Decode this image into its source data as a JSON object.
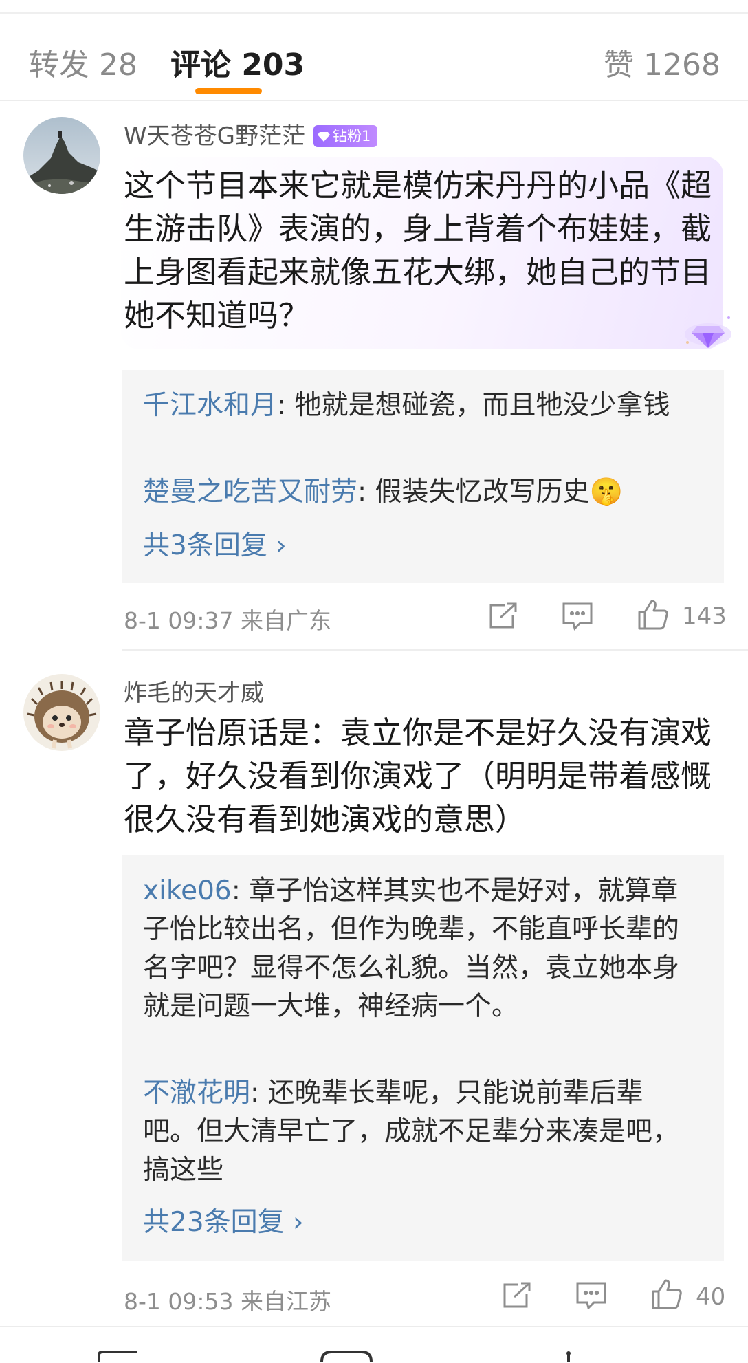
{
  "tabs": {
    "repost": "转发 28",
    "comments": "评论 203",
    "likes": "赞 1268"
  },
  "comments": [
    {
      "username": "W天苍苍G野茫茫",
      "badge": "钻粉1",
      "text": "这个节目本来它就是模仿宋丹丹的小品《超生游击队》表演的，身上背着个布娃娃，截上身图看起来就像五花大绑，她自己的节目她不知道吗？",
      "replies": [
        {
          "user": "千江水和月",
          "text": ": 牠就是想碰瓷，而且牠没少拿钱"
        },
        {
          "user": "楚曼之吃苦又耐劳",
          "text": ": 假装失忆改写历史🤫"
        }
      ],
      "more_replies": "共3条回复 ›",
      "time": "8-1 09:37",
      "location": "来自广东",
      "likes": "143"
    },
    {
      "username": "炸毛的天才威",
      "text": "章子怡原话是：袁立你是不是好久没有演戏了，好久没看到你演戏了（明明是带着感慨很久没有看到她演戏的意思）",
      "replies": [
        {
          "user": "xike06",
          "text": ": 章子怡这样其实也不是好对，就算章子怡比较出名，但作为晚辈，不能直呼长辈的名字吧？显得不怎么礼貌。当然，袁立她本身就是问题一大堆，神经病一个。"
        },
        {
          "user": "不澈花明",
          "text": ": 还晚辈长辈呢，只能说前辈后辈吧。但大清早亡了，成就不足辈分来凑是吧，搞这些"
        }
      ],
      "more_replies": "共23条回复 ›",
      "time": "8-1 09:53",
      "location": "来自江苏",
      "likes": "40"
    }
  ],
  "icons": {
    "repost": "share-icon",
    "comment": "comment-icon",
    "like": "thumb-up-icon",
    "badge": "diamond-icon"
  },
  "colors": {
    "accent": "#ff8a00",
    "link": "#4a7bae",
    "badge": "#a774ff"
  }
}
